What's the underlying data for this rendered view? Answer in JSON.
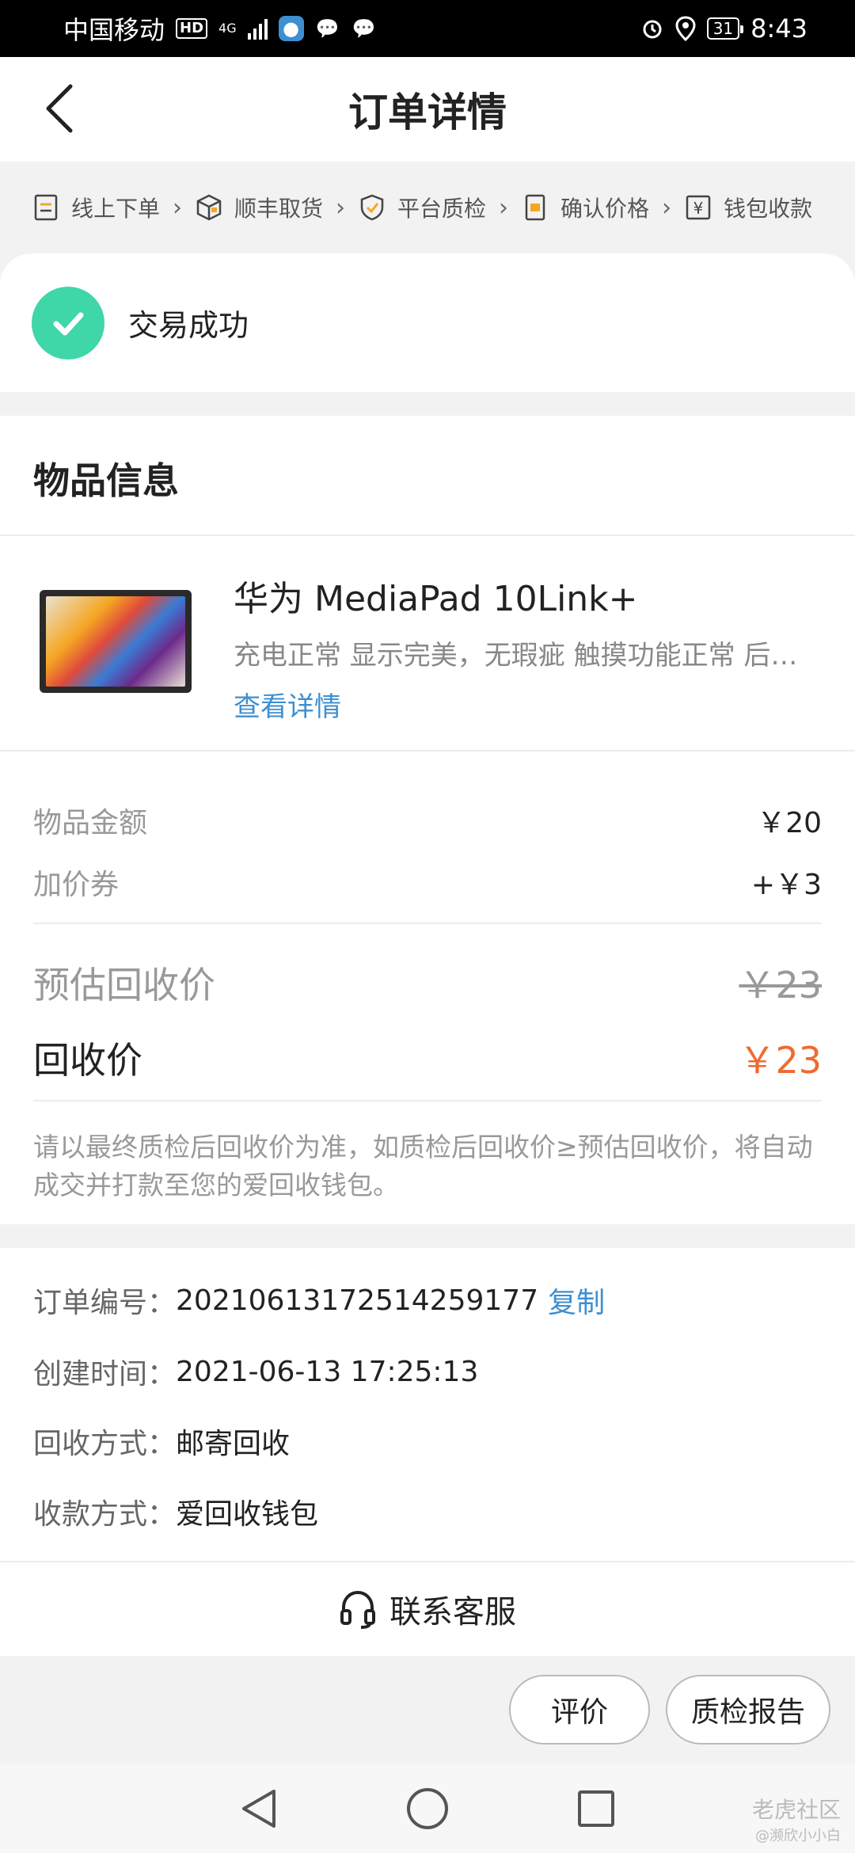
{
  "status_bar": {
    "carrier": "中国移动",
    "hd": "HD",
    "network": "4G",
    "battery": "31",
    "time": "8:43"
  },
  "header": {
    "title": "订单详情"
  },
  "steps": [
    {
      "label": "线上下单",
      "icon": "document-icon"
    },
    {
      "label": "顺丰取货",
      "icon": "package-icon"
    },
    {
      "label": "平台质检",
      "icon": "shield-check-icon"
    },
    {
      "label": "确认价格",
      "icon": "price-tag-icon"
    },
    {
      "label": "钱包收款",
      "icon": "yen-wallet-icon"
    }
  ],
  "status": {
    "text": "交易成功"
  },
  "product": {
    "section_title": "物品信息",
    "name": "华为 MediaPad 10Link+",
    "description": "充电正常 显示完美，无瑕疵 触摸功能正常 后…",
    "detail_link": "查看详情"
  },
  "pricing": {
    "item_amount_label": "物品金额",
    "item_amount": "￥20",
    "coupon_label": "加价券",
    "coupon_value": "+￥3",
    "estimated_label": "预估回收价",
    "estimated_value": "￥23",
    "final_label": "回收价",
    "final_value": "￥23",
    "note": "请以最终质检后回收价为准，如质检后回收价≥预估回收价，将自动成交并打款至您的爱回收钱包。"
  },
  "order": {
    "number_label": "订单编号：",
    "number": "20210613172514259177",
    "copy_label": "复制",
    "created_label": "创建时间：",
    "created": "2021-06-13 17:25:13",
    "method_label": "回收方式：",
    "method": "邮寄回收",
    "payment_label": "收款方式：",
    "payment": "爱回收钱包"
  },
  "service": {
    "label": "联系客服"
  },
  "actions": {
    "review": "评价",
    "report": "质检报告"
  },
  "watermark": {
    "main": "老虎社区",
    "sub": "@濒欣小小白"
  },
  "colors": {
    "accent_blue": "#3d8fd0",
    "success_green": "#3fd6a8",
    "price_orange": "#ef6a2f"
  }
}
